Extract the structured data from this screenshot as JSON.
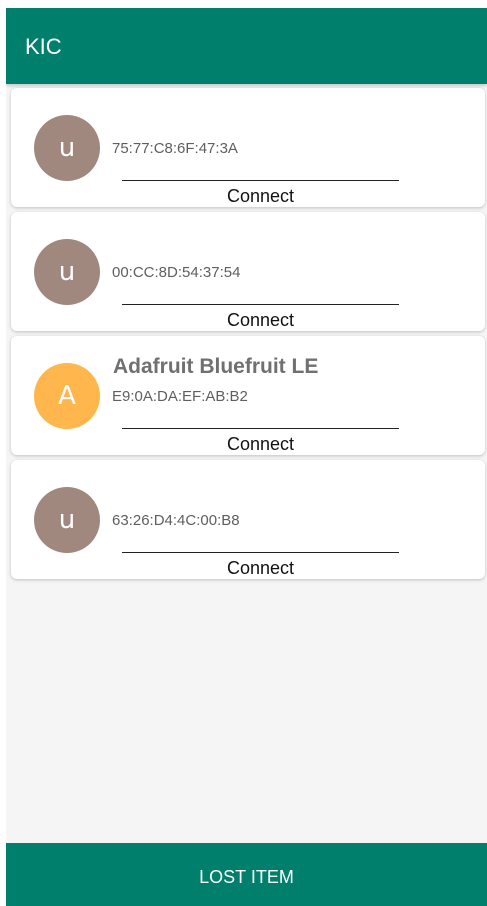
{
  "appbar": {
    "title": "KIC"
  },
  "colors": {
    "primary": "#00806c",
    "avatar_unknown": "#a1887f",
    "avatar_named": "#ffb74d"
  },
  "devices": [
    {
      "avatar_letter": "u",
      "name": "",
      "address": "75:77:C8:6F:47:3A",
      "connect_label": "Connect"
    },
    {
      "avatar_letter": "u",
      "name": "",
      "address": "00:CC:8D:54:37:54",
      "connect_label": "Connect"
    },
    {
      "avatar_letter": "A",
      "name": "Adafruit Bluefruit LE",
      "address": "E9:0A:DA:EF:AB:B2",
      "connect_label": "Connect"
    },
    {
      "avatar_letter": "u",
      "name": "",
      "address": "63:26:D4:4C:00:B8",
      "connect_label": "Connect"
    }
  ],
  "bottom_button": {
    "label": "LOST ITEM"
  }
}
